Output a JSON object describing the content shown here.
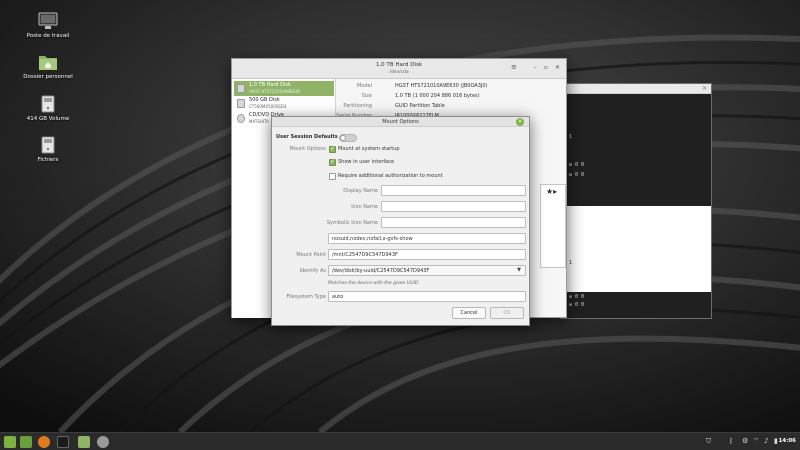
{
  "desktop": {
    "icons": [
      {
        "label": "Poste de travail",
        "icon": "computer-icon"
      },
      {
        "label": "Dossier personnel",
        "icon": "home-folder-icon"
      },
      {
        "label": "414 GB Volume",
        "icon": "drive-icon"
      },
      {
        "label": "Fichiers",
        "icon": "drive-icon"
      }
    ]
  },
  "terminal": {
    "lines": [
      "1",
      "w 0 0",
      "w 0 0",
      "1",
      "w 0 0",
      "w 0 0"
    ]
  },
  "disks": {
    "title": "1,0 TB Hard Disk",
    "subtitle": "/dev/sda",
    "drives": [
      {
        "name": "1,0 TB Hard Disk",
        "model": "HGST HTS721010A9E630",
        "selected": true
      },
      {
        "name": "500 GB Disk",
        "model": "CT500MX500SSD4",
        "selected": false
      },
      {
        "name": "CD/DVD Drive",
        "model": "MATSHITA",
        "selected": false
      }
    ],
    "info": [
      {
        "key": "Model",
        "value": "HGST HTS721010A9E630 (JB0OA3J0)"
      },
      {
        "key": "Size",
        "value": "1,0 TB (1 000 204 886 016 bytes)"
      },
      {
        "key": "Partitioning",
        "value": "GUID Partition Table"
      },
      {
        "key": "Serial Number",
        "value": "JR1000X6217FLM"
      }
    ]
  },
  "mount_dialog": {
    "title": "Mount Options",
    "user_session_defaults_label": "User Session Defaults",
    "user_session_defaults_on": false,
    "mount_options_label": "Mount Options",
    "checkboxes": [
      {
        "label": "Mount at system startup",
        "checked": true
      },
      {
        "label": "Show in user interface",
        "checked": true
      },
      {
        "label": "Require additional authorization to mount",
        "checked": false
      }
    ],
    "display_name_label": "Display Name",
    "display_name_value": "",
    "icon_name_label": "Icon Name",
    "icon_name_value": "",
    "symbolic_icon_name_label": "Symbolic Icon Name",
    "symbolic_icon_name_value": "",
    "options_value": "nosuid,nodev,nofail,x-gvfs-show",
    "mount_point_label": "Mount Point",
    "mount_point_value": "/mnt/C2547D9C547D943F",
    "identify_as_label": "Identify As",
    "identify_as_value": "/dev/disk/by-uuid/C2547D9C547D943F",
    "identify_hint": "Matches the device with the given UUID",
    "filesystem_type_label": "Filesystem Type",
    "filesystem_type_value": "auto",
    "cancel_label": "Cancel",
    "ok_label": "OK"
  },
  "taskbar": {
    "clock": "14:06"
  },
  "colors": {
    "accent": "#8fb466",
    "taskbar": "#2b2b2b"
  }
}
